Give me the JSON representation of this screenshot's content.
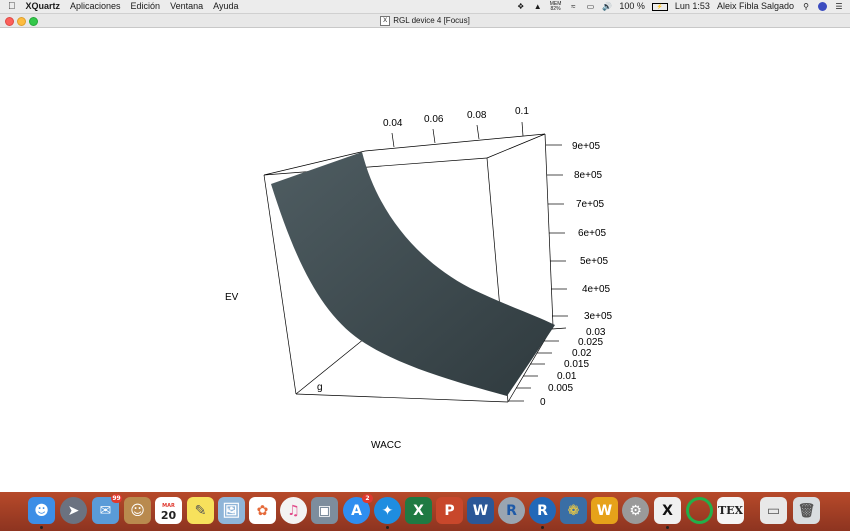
{
  "menubar": {
    "app_name": "XQuartz",
    "menus": [
      "Aplicaciones",
      "Edición",
      "Ventana",
      "Ayuda"
    ],
    "status": {
      "memory_label": "MEM",
      "memory_value": "82%",
      "battery": "100 %",
      "clock": "Lun 1:53",
      "user": "Aleix Fibla Salgado"
    }
  },
  "window": {
    "title": "RGL device 4 [Focus]"
  },
  "plot": {
    "axis_labels": {
      "y": "EV",
      "x": "WACC",
      "z": "g"
    },
    "top_ticks": [
      "0.04",
      "0.06",
      "0.08",
      "0.1"
    ],
    "right_ticks": [
      "9e+05",
      "8e+05",
      "7e+05",
      "6e+05",
      "5e+05",
      "4e+05",
      "3e+05"
    ],
    "g_ticks": [
      "0.03",
      "0.025",
      "0.02",
      "0.015",
      "0.01",
      "0.005",
      "0"
    ],
    "surface_color": "#3d4a4f"
  },
  "dock": {
    "calendar_month": "MAR",
    "calendar_day": "20",
    "mail_badge": "99",
    "appstore_badge": "2"
  }
}
